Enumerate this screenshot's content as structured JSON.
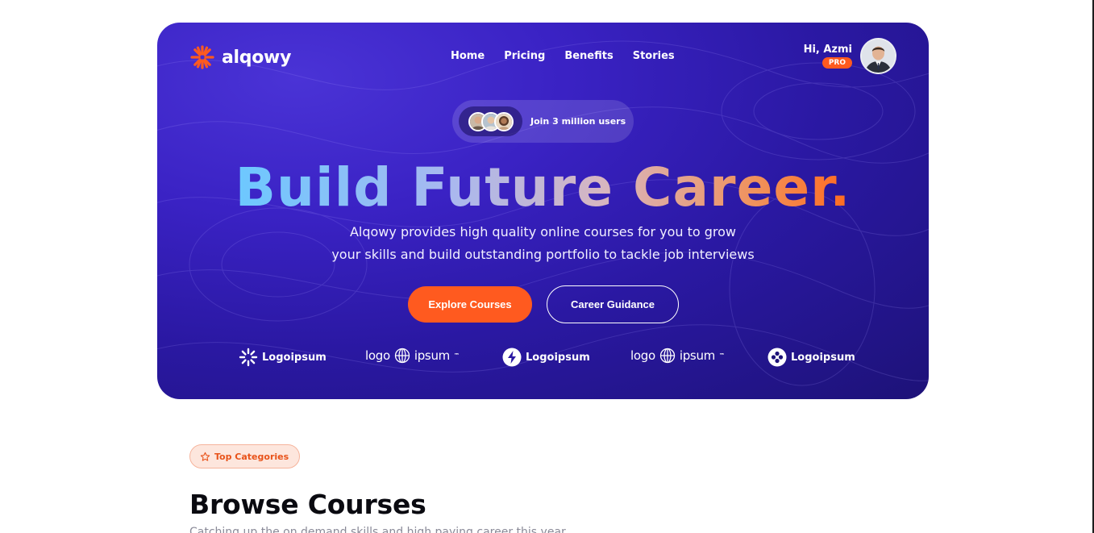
{
  "brand": {
    "name": "alqowy",
    "accent": "#ff5a1f",
    "hero_bg": "#3a22c4"
  },
  "nav": {
    "items": [
      "Home",
      "Pricing",
      "Benefits",
      "Stories"
    ]
  },
  "user": {
    "greeting": "Hi, Azmi",
    "badge": "PRO",
    "avatar_icon": "user-avatar"
  },
  "hero": {
    "join_text": "Join 3 million users",
    "headline": "Build Future Career.",
    "subtitle_line1": "Alqowy provides high quality online courses for you to grow",
    "subtitle_line2": "your skills and build outstanding portfolio to tackle job interviews",
    "primary_cta": "Explore Courses",
    "secondary_cta": "Career Guidance"
  },
  "brands": [
    {
      "icon": "sunburst-icon",
      "name": "Logoipsum"
    },
    {
      "icon": "globe-icon",
      "left": "logo",
      "right": "ipsum"
    },
    {
      "icon": "bolt-icon",
      "name": "Logoipsum"
    },
    {
      "icon": "globe-icon",
      "left": "logo",
      "right": "ipsum"
    },
    {
      "icon": "clover-icon",
      "name": "Logoipsum"
    }
  ],
  "categories": {
    "chip_label": "Top Categories",
    "title": "Browse Courses",
    "subtitle": "Catching up the on demand skills and high paying career this year"
  }
}
